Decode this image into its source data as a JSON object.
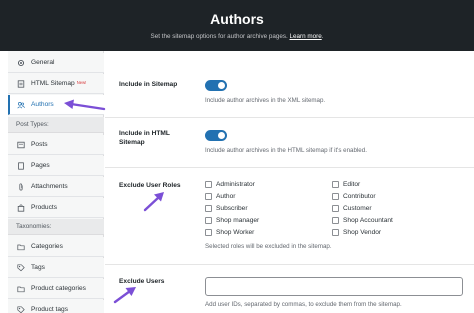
{
  "header": {
    "title": "Authors",
    "subtitle": "Set the sitemap options for author archive pages.",
    "learn_more": "Learn more"
  },
  "sidebar": {
    "items": [
      {
        "label": "General",
        "icon": "gear-icon"
      },
      {
        "label": "HTML Sitemap",
        "badge": "New!",
        "icon": "document-icon"
      },
      {
        "label": "Authors",
        "icon": "users-icon",
        "active": true
      }
    ],
    "post_types_heading": "Post Types:",
    "post_types": [
      {
        "label": "Posts",
        "icon": "posts-icon"
      },
      {
        "label": "Pages",
        "icon": "pages-icon"
      },
      {
        "label": "Attachments",
        "icon": "paperclip-icon"
      },
      {
        "label": "Products",
        "icon": "products-icon"
      }
    ],
    "taxonomies_heading": "Taxonomies:",
    "taxonomies": [
      {
        "label": "Categories",
        "icon": "folder-icon"
      },
      {
        "label": "Tags",
        "icon": "tag-icon"
      },
      {
        "label": "Product categories",
        "icon": "folder-icon"
      },
      {
        "label": "Product tags",
        "icon": "tag-icon"
      }
    ]
  },
  "settings": {
    "include_sitemap": {
      "label": "Include in Sitemap",
      "enabled": true,
      "description": "Include author archives in the XML sitemap."
    },
    "include_html": {
      "label_line1": "Include in HTML",
      "label_line2": "Sitemap",
      "enabled": true,
      "description": "Include author archives in the HTML sitemap if it's enabled."
    },
    "exclude_roles": {
      "label": "Exclude User Roles",
      "roles_left": [
        "Administrator",
        "Author",
        "Subscriber",
        "Shop manager",
        "Shop Worker"
      ],
      "roles_right": [
        "Editor",
        "Contributor",
        "Customer",
        "Shop Accountant",
        "Shop Vendor"
      ],
      "description": "Selected roles will be excluded in the sitemap."
    },
    "exclude_users": {
      "label": "Exclude Users",
      "value": "",
      "description": "Add user IDs, separated by commas, to exclude them from the sitemap."
    }
  },
  "colors": {
    "header_bg": "#1e2327",
    "accent": "#2271b1",
    "arrow": "#7b4fd6"
  }
}
